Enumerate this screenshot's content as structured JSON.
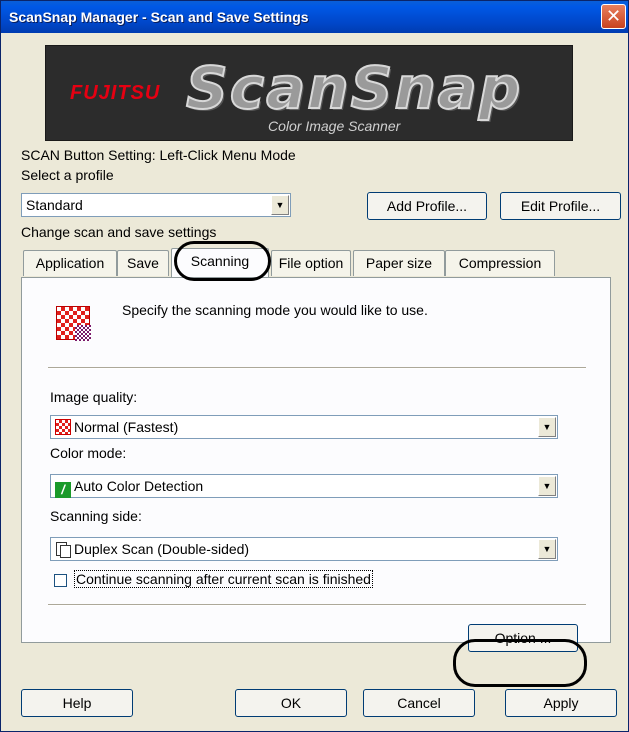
{
  "window": {
    "title": "ScanSnap Manager - Scan and Save Settings",
    "close_label": "✕"
  },
  "banner": {
    "brand": "FUJITSU",
    "product": "ScanSnap",
    "subtitle": "Color Image Scanner"
  },
  "scan_button_setting": "SCAN Button Setting: Left-Click Menu Mode",
  "profile": {
    "label": "Select a profile",
    "selected": "Standard",
    "add_label": "Add Profile...",
    "edit_label": "Edit Profile..."
  },
  "settings_heading": "Change scan and save settings",
  "tabs": [
    {
      "label": "Application"
    },
    {
      "label": "Save"
    },
    {
      "label": "Scanning",
      "active": true
    },
    {
      "label": "File option"
    },
    {
      "label": "Paper size"
    },
    {
      "label": "Compression"
    }
  ],
  "scanning": {
    "description": "Specify the scanning mode you would like to use.",
    "image_quality": {
      "label": "Image quality:",
      "value": "Normal (Fastest)"
    },
    "color_mode": {
      "label": "Color mode:",
      "value": "Auto Color Detection"
    },
    "scanning_side": {
      "label": "Scanning side:",
      "value": "Duplex Scan (Double-sided)"
    },
    "continue_checkbox": {
      "label": "Continue scanning after current scan is finished",
      "checked": false
    },
    "option_label": "Option ..."
  },
  "footer": {
    "help_label": "Help",
    "ok_label": "OK",
    "cancel_label": "Cancel",
    "apply_label": "Apply"
  }
}
